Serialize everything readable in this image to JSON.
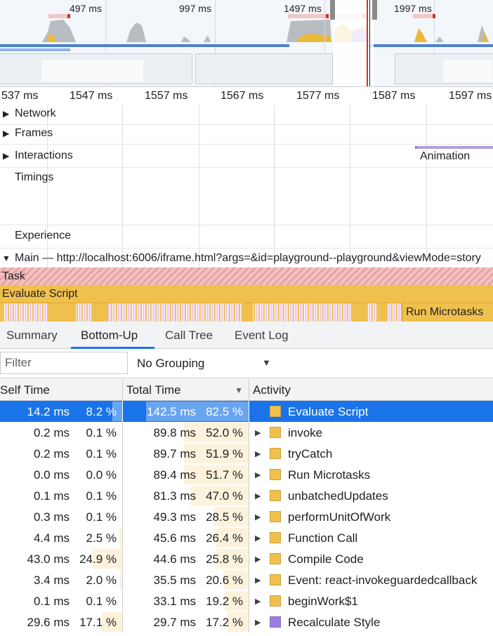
{
  "overview": {
    "time_labels": [
      "497 ms",
      "997 ms",
      "1497 ms",
      "1997 ms"
    ]
  },
  "ruler": {
    "labels": [
      "537 ms",
      "1547 ms",
      "1557 ms",
      "1567 ms",
      "1577 ms",
      "1587 ms",
      "1597 ms"
    ]
  },
  "tracks": {
    "network": "Network",
    "frames": "Frames",
    "interactions": "Interactions",
    "animation": "Animation",
    "timings": "Timings",
    "experience": "Experience",
    "main": "Main — http://localhost:6006/iframe.html?args=&id=playground--playground&viewMode=story"
  },
  "flame": {
    "task": "Task",
    "evaluate_script": "Evaluate Script",
    "run_microtasks": "Run Microtasks"
  },
  "tabs": [
    "Summary",
    "Bottom-Up",
    "Call Tree",
    "Event Log"
  ],
  "active_tab": "Bottom-Up",
  "filter": {
    "placeholder": "Filter",
    "value": ""
  },
  "grouping": {
    "selected": "No Grouping"
  },
  "table": {
    "headers": {
      "self": "Self Time",
      "total": "Total Time",
      "activity": "Activity"
    },
    "rows": [
      {
        "self_ms": "14.2 ms",
        "self_pct": "8.2 %",
        "self_frac": 0.082,
        "total_ms": "142.5 ms",
        "total_pct": "82.5 %",
        "total_frac": 0.825,
        "activity": "Evaluate Script",
        "color": "#f0c04c",
        "expandable": false,
        "selected": true
      },
      {
        "self_ms": "0.2 ms",
        "self_pct": "0.1 %",
        "self_frac": 0.001,
        "total_ms": "89.8 ms",
        "total_pct": "52.0 %",
        "total_frac": 0.52,
        "activity": "invoke",
        "color": "#f0c04c",
        "expandable": true
      },
      {
        "self_ms": "0.2 ms",
        "self_pct": "0.1 %",
        "self_frac": 0.001,
        "total_ms": "89.7 ms",
        "total_pct": "51.9 %",
        "total_frac": 0.519,
        "activity": "tryCatch",
        "color": "#f0c04c",
        "expandable": true
      },
      {
        "self_ms": "0.0 ms",
        "self_pct": "0.0 %",
        "self_frac": 0.0,
        "total_ms": "89.4 ms",
        "total_pct": "51.7 %",
        "total_frac": 0.517,
        "activity": "Run Microtasks",
        "color": "#f0c04c",
        "expandable": true
      },
      {
        "self_ms": "0.1 ms",
        "self_pct": "0.1 %",
        "self_frac": 0.001,
        "total_ms": "81.3 ms",
        "total_pct": "47.0 %",
        "total_frac": 0.47,
        "activity": "unbatchedUpdates",
        "color": "#f0c04c",
        "expandable": true
      },
      {
        "self_ms": "0.3 ms",
        "self_pct": "0.1 %",
        "self_frac": 0.001,
        "total_ms": "49.3 ms",
        "total_pct": "28.5 %",
        "total_frac": 0.285,
        "activity": "performUnitOfWork",
        "color": "#f0c04c",
        "expandable": true
      },
      {
        "self_ms": "4.4 ms",
        "self_pct": "2.5 %",
        "self_frac": 0.025,
        "total_ms": "45.6 ms",
        "total_pct": "26.4 %",
        "total_frac": 0.264,
        "activity": "Function Call",
        "color": "#f0c04c",
        "expandable": true
      },
      {
        "self_ms": "43.0 ms",
        "self_pct": "24.9 %",
        "self_frac": 0.249,
        "total_ms": "44.6 ms",
        "total_pct": "25.8 %",
        "total_frac": 0.258,
        "activity": "Compile Code",
        "color": "#f0c04c",
        "expandable": true
      },
      {
        "self_ms": "3.4 ms",
        "self_pct": "2.0 %",
        "self_frac": 0.02,
        "total_ms": "35.5 ms",
        "total_pct": "20.6 %",
        "total_frac": 0.206,
        "activity": "Event: react-invokeguardedcallback",
        "color": "#f0c04c",
        "expandable": true
      },
      {
        "self_ms": "0.1 ms",
        "self_pct": "0.1 %",
        "self_frac": 0.001,
        "total_ms": "33.1 ms",
        "total_pct": "19.2 %",
        "total_frac": 0.192,
        "activity": "beginWork$1",
        "color": "#f0c04c",
        "expandable": true
      },
      {
        "self_ms": "29.6 ms",
        "self_pct": "17.1 %",
        "self_frac": 0.171,
        "total_ms": "29.7 ms",
        "total_pct": "17.2 %",
        "total_frac": 0.172,
        "activity": "Recalculate Style",
        "color": "#9b7fe0",
        "expandable": true
      }
    ]
  }
}
